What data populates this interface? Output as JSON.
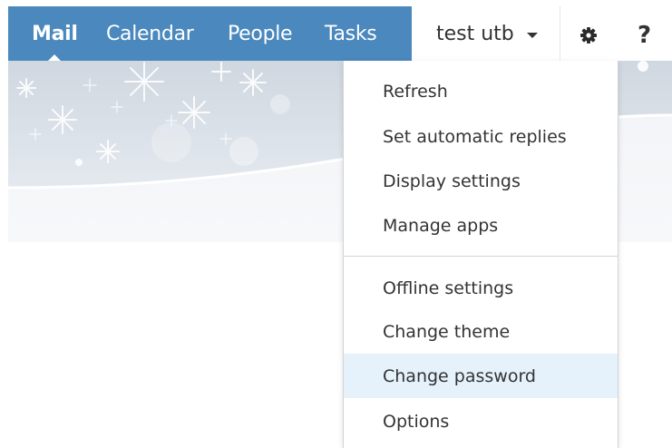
{
  "nav": {
    "mail": "Mail",
    "calendar": "Calendar",
    "people": "People",
    "tasks": "Tasks",
    "active": "Mail"
  },
  "user": {
    "name": "test utb"
  },
  "help": {
    "label": "?"
  },
  "icons": {
    "settings": "gear-icon",
    "help": "help-icon",
    "user_menu": "caret-down-icon"
  },
  "settings_menu": {
    "items": [
      {
        "label": "Refresh"
      },
      {
        "label": "Set automatic replies"
      },
      {
        "label": "Display settings"
      },
      {
        "label": "Manage apps"
      },
      {
        "label": "Offline settings"
      },
      {
        "label": "Change theme"
      },
      {
        "label": "Change password"
      },
      {
        "label": "Options"
      }
    ],
    "highlighted": "Change password"
  },
  "colors": {
    "nav_bar": "#4a88bd",
    "menu_hover": "#e5f1fb",
    "text": "#333333"
  }
}
